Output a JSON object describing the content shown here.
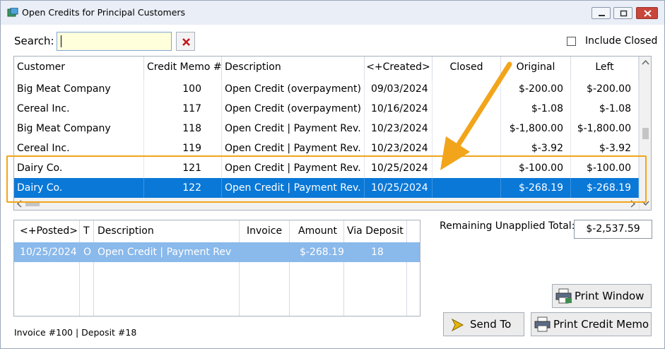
{
  "window": {
    "title": "Open Credits for Principal Customers"
  },
  "toolbar": {
    "search_label": "Search:",
    "search_value": "",
    "include_closed_label": "Include Closed",
    "include_closed_checked": false
  },
  "credits_grid": {
    "columns": [
      "Customer",
      "Credit Memo #",
      "Description",
      "<+Created>",
      "Closed",
      "Original",
      "Left"
    ],
    "rows": [
      {
        "customer": "Big Meat Company",
        "memo": "100",
        "description": "Open Credit (overpayment)",
        "created": "09/03/2024",
        "closed": "",
        "original": "$-200.00",
        "left": "$-200.00"
      },
      {
        "customer": "Cereal Inc.",
        "memo": "117",
        "description": "Open Credit (overpayment)",
        "created": "10/16/2024",
        "closed": "",
        "original": "$-1.08",
        "left": "$-1.08"
      },
      {
        "customer": "Big Meat Company",
        "memo": "118",
        "description": "Open Credit | Payment Rev.",
        "created": "10/23/2024",
        "closed": "",
        "original": "$-1,800.00",
        "left": "$-1,800.00"
      },
      {
        "customer": "Cereal Inc.",
        "memo": "119",
        "description": "Open Credit | Payment Rev.",
        "created": "10/23/2024",
        "closed": "",
        "original": "$-3.92",
        "left": "$-3.92"
      },
      {
        "customer": "Dairy Co.",
        "memo": "121",
        "description": "Open Credit | Payment Rev.",
        "created": "10/25/2024",
        "closed": "",
        "original": "$-100.00",
        "left": "$-100.00"
      },
      {
        "customer": "Dairy Co.",
        "memo": "122",
        "description": "Open Credit | Payment Rev.",
        "created": "10/25/2024",
        "closed": "",
        "original": "$-268.19",
        "left": "$-268.19"
      }
    ]
  },
  "detail_grid": {
    "columns": [
      "<+Posted>",
      "T",
      "Description",
      "Invoice",
      "Amount",
      "Via Deposit"
    ],
    "rows": [
      {
        "posted": "10/25/2024",
        "t": "O",
        "description": "Open Credit | Payment Rev",
        "invoice": "",
        "amount": "$-268.19",
        "via_deposit": "18"
      }
    ]
  },
  "remaining": {
    "label": "Remaining Unapplied Total:",
    "value": "$-2,537.59"
  },
  "buttons": {
    "print_window": "Print Window",
    "send_to": "Send To",
    "print_credit_memo": "Print Credit Memo"
  },
  "status": "Invoice #100 | Deposit #18",
  "colors": {
    "selection": "#0a78d7",
    "highlight_box": "#f2a51a",
    "detail_selection": "#8ab9eb"
  }
}
